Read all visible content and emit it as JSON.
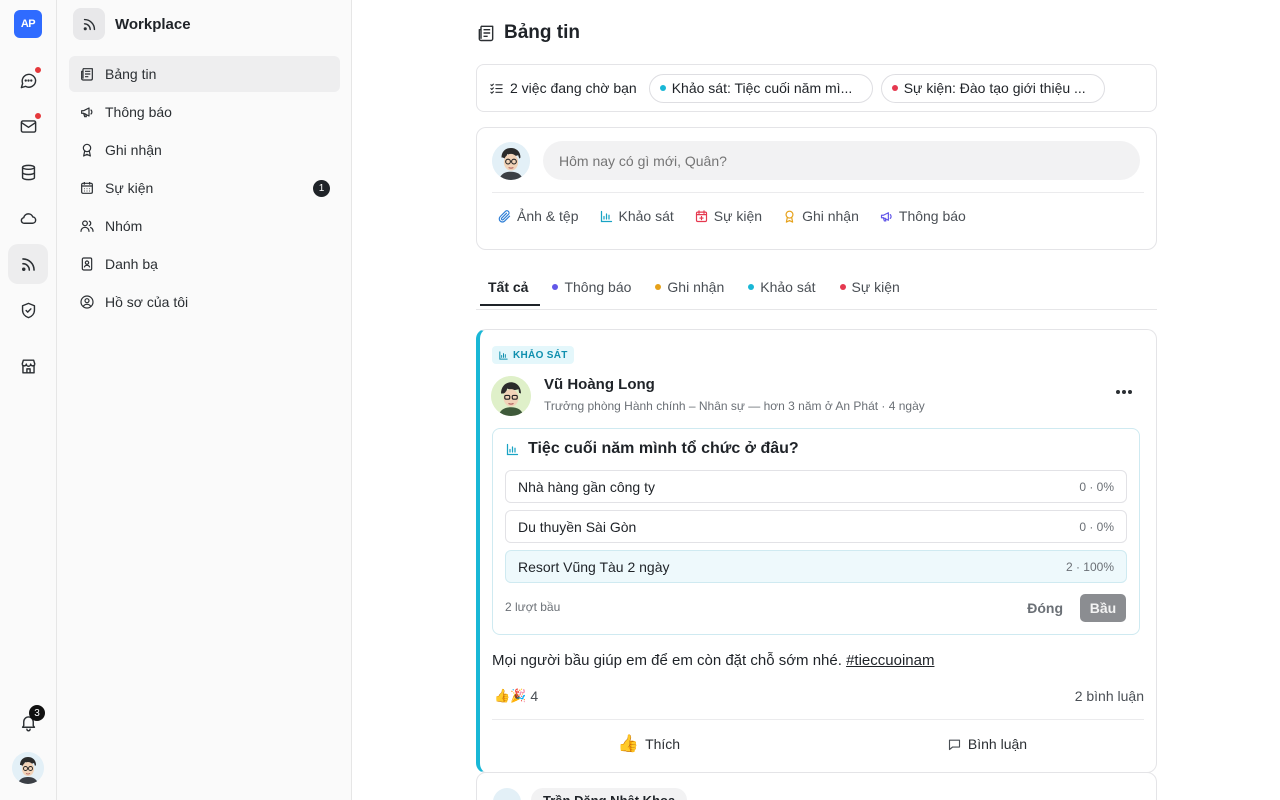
{
  "app": {
    "logo_text": "AP",
    "workspace_title": "Workplace"
  },
  "rail": {
    "notification_count": "3"
  },
  "sidebar": {
    "items": [
      {
        "label": "Bảng tin",
        "icon": "newspaper-icon",
        "active": true
      },
      {
        "label": "Thông báo",
        "icon": "megaphone-icon"
      },
      {
        "label": "Ghi nhận",
        "icon": "award-icon"
      },
      {
        "label": "Sự kiện",
        "icon": "calendar-icon",
        "count": "1"
      },
      {
        "label": "Nhóm",
        "icon": "users-icon"
      },
      {
        "label": "Danh bạ",
        "icon": "contact-icon"
      },
      {
        "label": "Hồ sơ của tôi",
        "icon": "user-circle-icon"
      }
    ]
  },
  "page": {
    "title": "Bảng tin"
  },
  "pending": {
    "label": "2 việc đang chờ bạn",
    "chips": [
      {
        "text": "Khảo sát: Tiệc cuối năm mì...",
        "color": "#19b7d6"
      },
      {
        "text": "Sự kiện: Đào tạo giới thiệu ...",
        "color": "#e5384f"
      }
    ]
  },
  "composer": {
    "placeholder": "Hôm nay có gì mới, Quân?",
    "actions": [
      "Ảnh & tệp",
      "Khảo sát",
      "Sự kiện",
      "Ghi nhận",
      "Thông báo"
    ]
  },
  "tabs": [
    {
      "label": "Tất cả",
      "active": true
    },
    {
      "label": "Thông báo",
      "color": "#6257e8"
    },
    {
      "label": "Ghi nhận",
      "color": "#e6a11a"
    },
    {
      "label": "Khảo sát",
      "color": "#19b7d6"
    },
    {
      "label": "Sự kiện",
      "color": "#e5384f"
    }
  ],
  "post": {
    "tag": "KHẢO SÁT",
    "author": "Vũ Hoàng Long",
    "meta": "Trưởng phòng Hành chính – Nhân sự — hơn 3 năm ở An Phát · 4 ngày",
    "poll": {
      "question": "Tiệc cuối năm mình tổ chức ở đâu?",
      "options": [
        {
          "label": "Nhà hàng gần công ty",
          "result": "0 · 0%",
          "percent": 0
        },
        {
          "label": "Du thuyền Sài Gòn",
          "result": "0 · 0%",
          "percent": 0
        },
        {
          "label": "Resort Vũng Tàu 2 ngày",
          "result": "2 · 100%",
          "percent": 100
        }
      ],
      "votes_label": "2 lượt bầu",
      "close_label": "Đóng",
      "vote_label": "Bầu"
    },
    "body_text": "Mọi người bầu giúp em để em còn đặt chỗ sớm nhé. ",
    "hashtag": "#tieccuoinam",
    "reactions_emoji": "👍🎉",
    "reactions_count": "4",
    "comments_label": "2 bình luận",
    "like_label": "Thích",
    "comment_label": "Bình luận"
  },
  "post2": {
    "author": "Trần Đặng Nhật Khoa"
  },
  "colors": {
    "accent_poll": "#19b7d6",
    "logo": "#2f6bff"
  }
}
